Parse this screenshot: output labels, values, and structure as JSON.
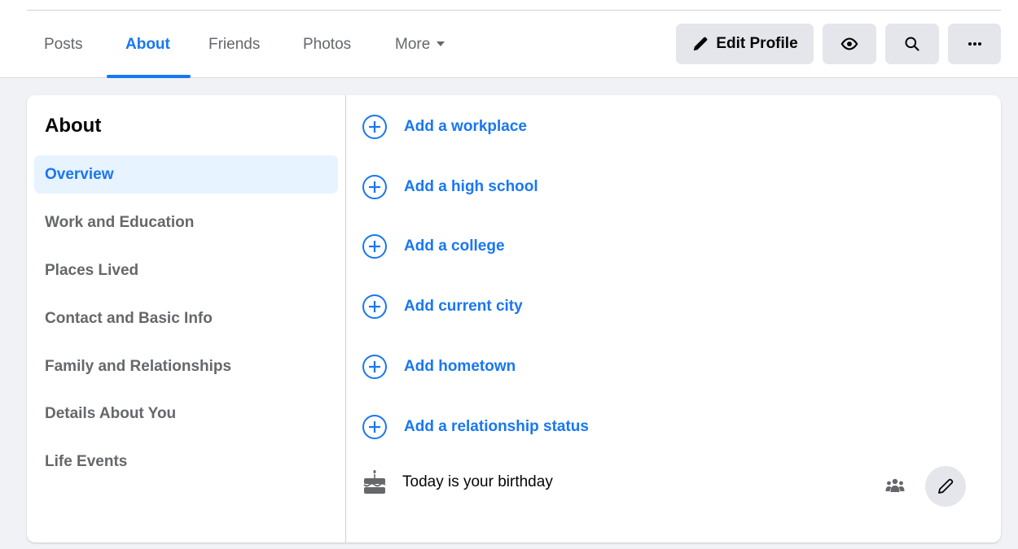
{
  "tabs": [
    {
      "label": "Posts",
      "active": false
    },
    {
      "label": "About",
      "active": true
    },
    {
      "label": "Friends",
      "active": false
    },
    {
      "label": "Photos",
      "active": false
    },
    {
      "label": "More",
      "active": false
    }
  ],
  "actions": {
    "edit_profile_label": "Edit Profile",
    "view_as_icon": "eye-icon",
    "search_icon": "search-icon",
    "more_label": "···"
  },
  "about": {
    "heading": "About",
    "nav": [
      {
        "label": "Overview",
        "active": true
      },
      {
        "label": "Work and Education",
        "active": false
      },
      {
        "label": "Places Lived",
        "active": false
      },
      {
        "label": "Contact and Basic Info",
        "active": false
      },
      {
        "label": "Family and Relationships",
        "active": false
      },
      {
        "label": "Details About You",
        "active": false
      },
      {
        "label": "Life Events",
        "active": false
      }
    ],
    "add_items": [
      "Add a workplace",
      "Add a high school",
      "Add a college",
      "Add current city",
      "Add hometown",
      "Add a relationship status"
    ],
    "birthday": {
      "icon": "birthday-cake-icon",
      "text": "Today is your birthday",
      "audience_icon": "friends-audience-icon",
      "edit_icon": "pencil-icon"
    }
  },
  "colors": {
    "accent": "#1877f2",
    "active_bg": "#e7f3ff",
    "button_bg": "#e4e6eb",
    "muted_text": "#65676b",
    "page_bg": "#f0f2f5"
  }
}
